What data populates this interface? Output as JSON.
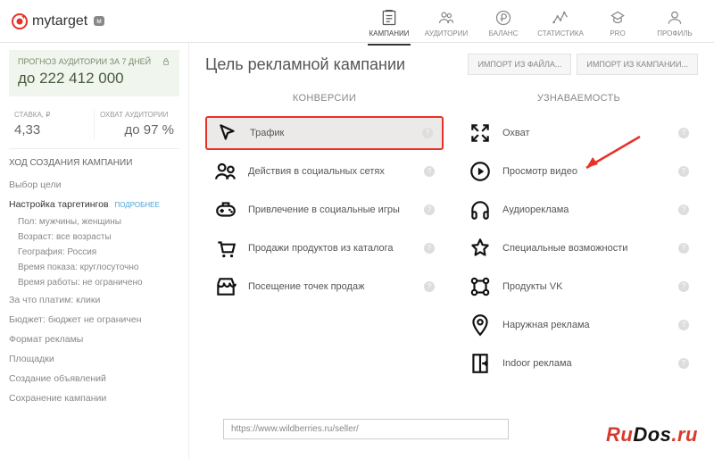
{
  "brand": {
    "name": "mytarget",
    "prime_badge": "м"
  },
  "nav": {
    "items": [
      {
        "label": "КАМПАНИИ"
      },
      {
        "label": "АУДИТОРИИ"
      },
      {
        "label": "БАЛАНС"
      },
      {
        "label": "СТАТИСТИКА"
      },
      {
        "label": "PRO"
      },
      {
        "label": "ПРОФИЛЬ"
      }
    ]
  },
  "sidebar": {
    "forecast_label": "ПРОГНОЗ АУДИТОРИИ ЗА 7 ДНЕЙ",
    "forecast_value": "до 222 412 000",
    "bid_label": "СТАВКА, ₽",
    "bid_value": "4,33",
    "reach_label": "ОХВАТ АУДИТОРИИ",
    "reach_value": "до 97 %",
    "heading": "ХОД СОЗДАНИЯ КАМПАНИИ",
    "steps": {
      "goal": "Выбор цели",
      "targeting": "Настройка таргетингов",
      "targeting_more": "ПОДРОБНЕЕ",
      "sub": {
        "gender": "Пол: мужчины, женщины",
        "age": "Возраст: все возрасты",
        "geo": "География: Россия",
        "time": "Время показа: круглосуточно",
        "work": "Время работы: не ограничено"
      },
      "pay": "За что платим: клики",
      "budget": "Бюджет: бюджет не ограничен",
      "format": "Формат рекламы",
      "placements": "Площадки",
      "creatives": "Создание объявлений",
      "save": "Сохранение кампании"
    }
  },
  "main": {
    "title": "Цель рекламной кампании",
    "import_file": "ИМПОРТ ИЗ ФАЙЛА...",
    "import_campaign": "ИМПОРТ ИЗ КАМПАНИИ...",
    "col_conversions": "КОНВЕРСИИ",
    "col_awareness": "УЗНАВАЕМОСТЬ",
    "goals_left": [
      "Трафик",
      "Действия в социальных сетях",
      "Привлечение в социальные игры",
      "Продажи продуктов из каталога",
      "Посещение точек продаж"
    ],
    "goals_right": [
      "Охват",
      "Просмотр видео",
      "Аудиореклама",
      "Специальные возможности",
      "Продукты VK",
      "Наружная реклама",
      "Indoor реклама"
    ],
    "url_value": "https://www.wildberries.ru/seller/"
  },
  "watermark": {
    "a": "Ru",
    "b": "Dos",
    "c": ".ru"
  }
}
